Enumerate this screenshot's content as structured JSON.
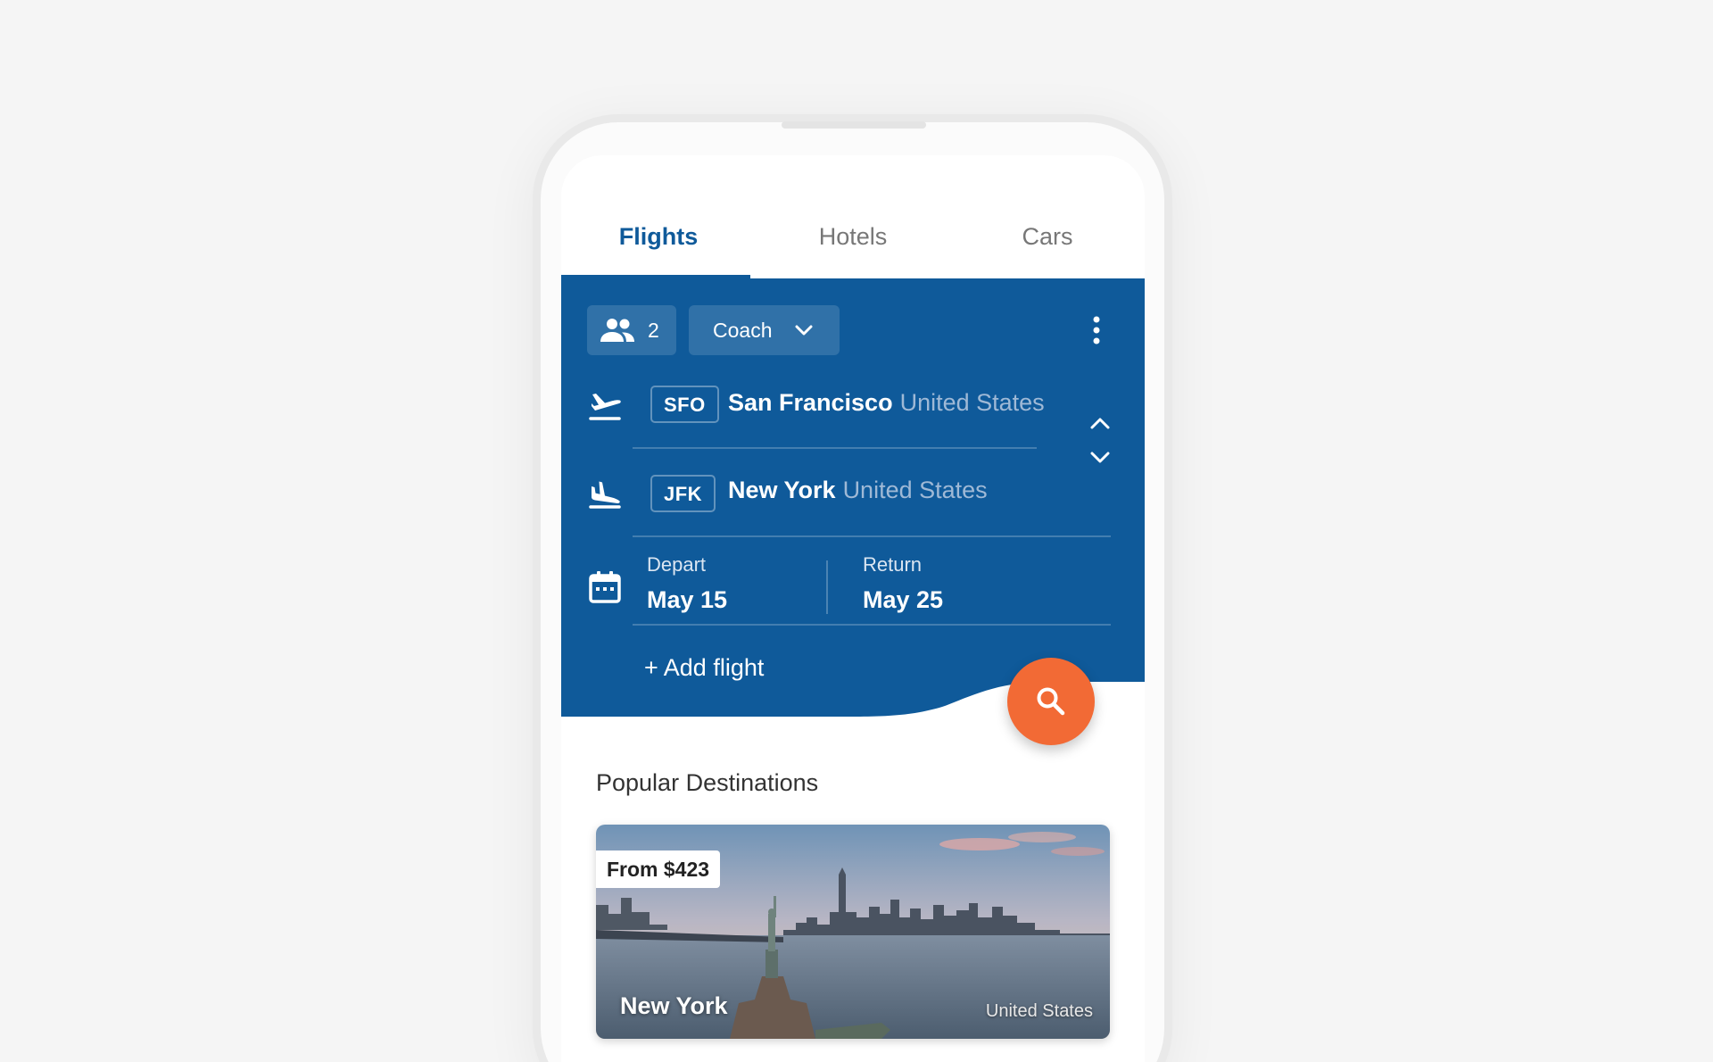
{
  "tabs": [
    {
      "label": "Flights"
    },
    {
      "label": "Hotels"
    },
    {
      "label": "Cars"
    }
  ],
  "search": {
    "travelers": "2",
    "cabin_class": "Coach",
    "origin": {
      "code": "SFO",
      "city": "San Francisco",
      "country": "United States"
    },
    "destination": {
      "code": "JFK",
      "city": "New York",
      "country": "United States"
    },
    "depart": {
      "label": "Depart",
      "date": "May 15"
    },
    "return": {
      "label": "Return",
      "date": "May 25"
    },
    "add_flight": "+ Add flight"
  },
  "popular": {
    "title": "Popular Destinations",
    "cards": [
      {
        "price": "From $423",
        "city": "New York",
        "country": "United States"
      }
    ]
  },
  "colors": {
    "primary": "#0f5a9a",
    "accent": "#f26a35",
    "background": "#f5f5f5"
  },
  "icons": {
    "travelers": "people-icon",
    "class_dropdown": "chevron-down-icon",
    "more": "more-vert-icon",
    "takeoff": "flight-takeoff-icon",
    "landing": "flight-land-icon",
    "swap_up": "chevron-up-icon",
    "swap_down": "chevron-down-icon",
    "calendar": "calendar-icon",
    "search": "search-icon"
  }
}
